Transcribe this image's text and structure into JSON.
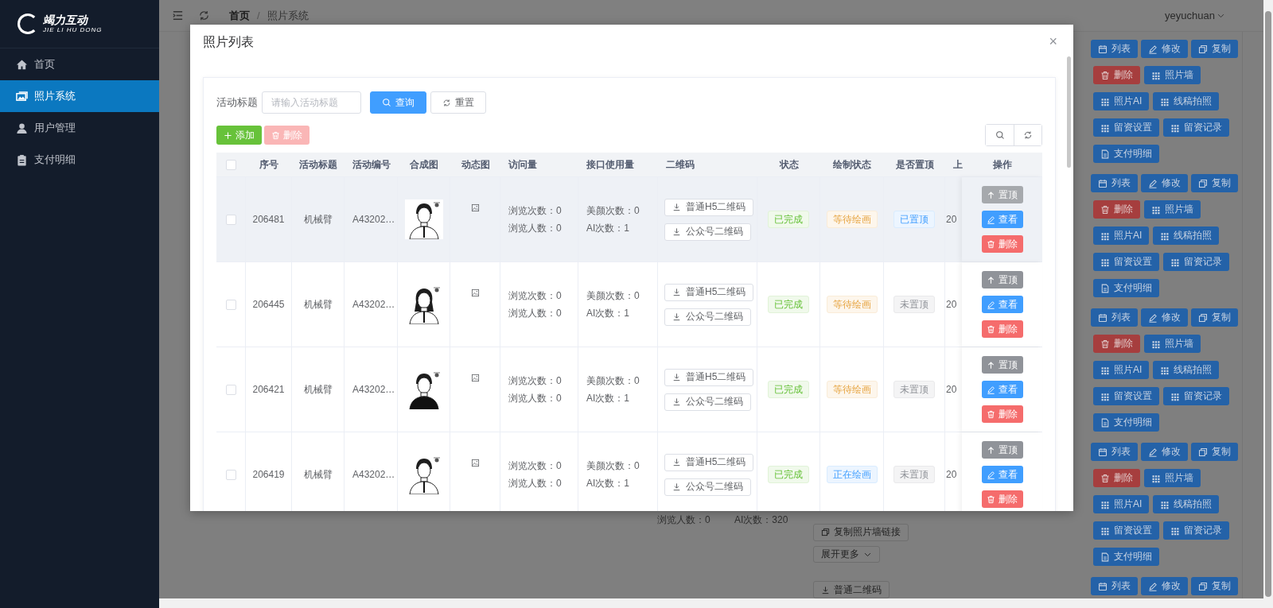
{
  "sidebar": {
    "logo": {
      "title": "竭力互动",
      "subtitle": "JIE LI HU DONG"
    },
    "items": [
      {
        "label": "首页",
        "kind": "home",
        "selected": false
      },
      {
        "label": "照片系统",
        "kind": "photos",
        "selected": true
      },
      {
        "label": "用户管理",
        "kind": "users",
        "selected": false
      },
      {
        "label": "支付明细",
        "kind": "payments",
        "selected": false
      }
    ]
  },
  "header": {
    "breadcrumb": [
      "首页",
      "照片系统"
    ],
    "separator": "/",
    "user": "yeyuchuan"
  },
  "background": {
    "action_groups": [
      [
        [
          {
            "label": "列表",
            "kind": "list"
          },
          {
            "label": "修改",
            "kind": "edit"
          },
          {
            "label": "复制",
            "kind": "copy"
          }
        ],
        [
          {
            "label": "删除",
            "kind": "delete"
          },
          {
            "label": "照片墙",
            "kind": "feature"
          }
        ],
        [
          {
            "label": "照片AI",
            "kind": "feature"
          },
          {
            "label": "线稿拍照",
            "kind": "feature"
          }
        ],
        [
          {
            "label": "留资设置",
            "kind": "feature"
          },
          {
            "label": "留资记录",
            "kind": "feature"
          }
        ],
        [
          {
            "label": "支付明细",
            "kind": "payment"
          }
        ]
      ],
      [
        [
          {
            "label": "列表",
            "kind": "list"
          },
          {
            "label": "修改",
            "kind": "edit"
          },
          {
            "label": "复制",
            "kind": "copy"
          }
        ],
        [
          {
            "label": "删除",
            "kind": "delete"
          },
          {
            "label": "照片墙",
            "kind": "feature"
          }
        ],
        [
          {
            "label": "照片AI",
            "kind": "feature"
          },
          {
            "label": "线稿拍照",
            "kind": "feature"
          }
        ],
        [
          {
            "label": "留资设置",
            "kind": "feature"
          },
          {
            "label": "留资记录",
            "kind": "feature"
          }
        ],
        [
          {
            "label": "支付明细",
            "kind": "payment"
          }
        ]
      ],
      [
        [
          {
            "label": "列表",
            "kind": "list"
          },
          {
            "label": "修改",
            "kind": "edit"
          },
          {
            "label": "复制",
            "kind": "copy"
          }
        ],
        [
          {
            "label": "删除",
            "kind": "delete"
          },
          {
            "label": "照片墙",
            "kind": "feature"
          }
        ],
        [
          {
            "label": "照片AI",
            "kind": "feature"
          },
          {
            "label": "线稿拍照",
            "kind": "feature"
          }
        ],
        [
          {
            "label": "留资设置",
            "kind": "feature"
          },
          {
            "label": "留资记录",
            "kind": "feature"
          }
        ],
        [
          {
            "label": "支付明细",
            "kind": "payment"
          }
        ]
      ],
      [
        [
          {
            "label": "列表",
            "kind": "list"
          },
          {
            "label": "修改",
            "kind": "edit"
          },
          {
            "label": "复制",
            "kind": "copy"
          }
        ],
        [
          {
            "label": "删除",
            "kind": "delete"
          },
          {
            "label": "照片墙",
            "kind": "feature"
          }
        ],
        [
          {
            "label": "照片AI",
            "kind": "feature"
          },
          {
            "label": "线稿拍照",
            "kind": "feature"
          }
        ],
        [
          {
            "label": "留资设置",
            "kind": "feature"
          },
          {
            "label": "留资记录",
            "kind": "feature"
          }
        ],
        [
          {
            "label": "支付明细",
            "kind": "payment"
          }
        ]
      ],
      [
        [
          {
            "label": "列表",
            "kind": "list"
          },
          {
            "label": "修改",
            "kind": "edit"
          },
          {
            "label": "复制",
            "kind": "copy"
          }
        ]
      ]
    ],
    "row_texts": [
      "浏览人数：0",
      "AI次数：320"
    ],
    "row_buttons": [
      {
        "label": "复制照片墙链接",
        "kind": "copy"
      },
      {
        "label": "展开更多",
        "kind": "expand"
      },
      {
        "label": "普通二维码",
        "kind": "download"
      }
    ]
  },
  "modal": {
    "title": "照片列表",
    "close": "×",
    "filter": {
      "label": "活动标题",
      "placeholder": "请输入活动标题",
      "search_button": "查询",
      "reset_button": "重置"
    },
    "toolbar": {
      "add_button": {
        "label": "添加",
        "disabled": false
      },
      "delete_button": {
        "label": "删除",
        "disabled": true
      }
    },
    "table": {
      "columns": [
        "序号",
        "活动标题",
        "活动编号",
        "合成图",
        "动态图",
        "访问量",
        "接口使用量",
        "二维码",
        "状态",
        "绘制状态",
        "是否置顶",
        "上",
        "操作"
      ],
      "header_checked": false,
      "rows": [
        {
          "checked": false,
          "highlighted": true,
          "id": "206481",
          "title": "机械臂",
          "code": "A43202…",
          "visits": [
            "浏览次数：0",
            "浏览人数：0"
          ],
          "api_usage": [
            "美颜次数：0",
            "AI次数：1"
          ],
          "qr_buttons": [
            "普通H5二维码",
            "公众号二维码"
          ],
          "status": "已完成",
          "draw_status": {
            "text": "等待绘画",
            "kind": "waiting"
          },
          "pinned": {
            "text": "已置顶",
            "on": true
          },
          "column_13": "20",
          "actions": [
            {
              "label": "置顶",
              "kind": "pin",
              "disabled": true
            },
            {
              "label": "查看",
              "kind": "view",
              "disabled": false
            },
            {
              "label": "删除",
              "kind": "delete",
              "disabled": false
            }
          ]
        },
        {
          "checked": false,
          "highlighted": false,
          "id": "206445",
          "title": "机械臂",
          "code": "A43202…",
          "visits": [
            "浏览次数：0",
            "浏览人数：0"
          ],
          "api_usage": [
            "美颜次数：0",
            "AI次数：1"
          ],
          "qr_buttons": [
            "普通H5二维码",
            "公众号二维码"
          ],
          "status": "已完成",
          "draw_status": {
            "text": "等待绘画",
            "kind": "waiting"
          },
          "pinned": {
            "text": "未置顶",
            "on": false
          },
          "column_13": "20",
          "actions": [
            {
              "label": "置顶",
              "kind": "pin",
              "disabled": false
            },
            {
              "label": "查看",
              "kind": "view",
              "disabled": false
            },
            {
              "label": "删除",
              "kind": "delete",
              "disabled": false
            }
          ]
        },
        {
          "checked": false,
          "highlighted": false,
          "id": "206421",
          "title": "机械臂",
          "code": "A43202…",
          "visits": [
            "浏览次数：0",
            "浏览人数：0"
          ],
          "api_usage": [
            "美颜次数：0",
            "AI次数：1"
          ],
          "qr_buttons": [
            "普通H5二维码",
            "公众号二维码"
          ],
          "status": "已完成",
          "draw_status": {
            "text": "等待绘画",
            "kind": "waiting"
          },
          "pinned": {
            "text": "未置顶",
            "on": false
          },
          "column_13": "20",
          "actions": [
            {
              "label": "置顶",
              "kind": "pin",
              "disabled": false
            },
            {
              "label": "查看",
              "kind": "view",
              "disabled": false
            },
            {
              "label": "删除",
              "kind": "delete",
              "disabled": false
            }
          ]
        },
        {
          "checked": false,
          "highlighted": false,
          "id": "206419",
          "title": "机械臂",
          "code": "A43202…",
          "visits": [
            "浏览次数：0",
            "浏览人数：0"
          ],
          "api_usage": [
            "美颜次数：0",
            "AI次数：1"
          ],
          "qr_buttons": [
            "普通H5二维码",
            "公众号二维码"
          ],
          "status": "已完成",
          "draw_status": {
            "text": "正在绘画",
            "kind": "drawing"
          },
          "pinned": {
            "text": "未置顶",
            "on": false
          },
          "column_13": "20",
          "actions": [
            {
              "label": "置顶",
              "kind": "pin",
              "disabled": false
            },
            {
              "label": "查看",
              "kind": "view",
              "disabled": false
            },
            {
              "label": "删除",
              "kind": "delete",
              "disabled": false
            }
          ]
        }
      ]
    }
  }
}
